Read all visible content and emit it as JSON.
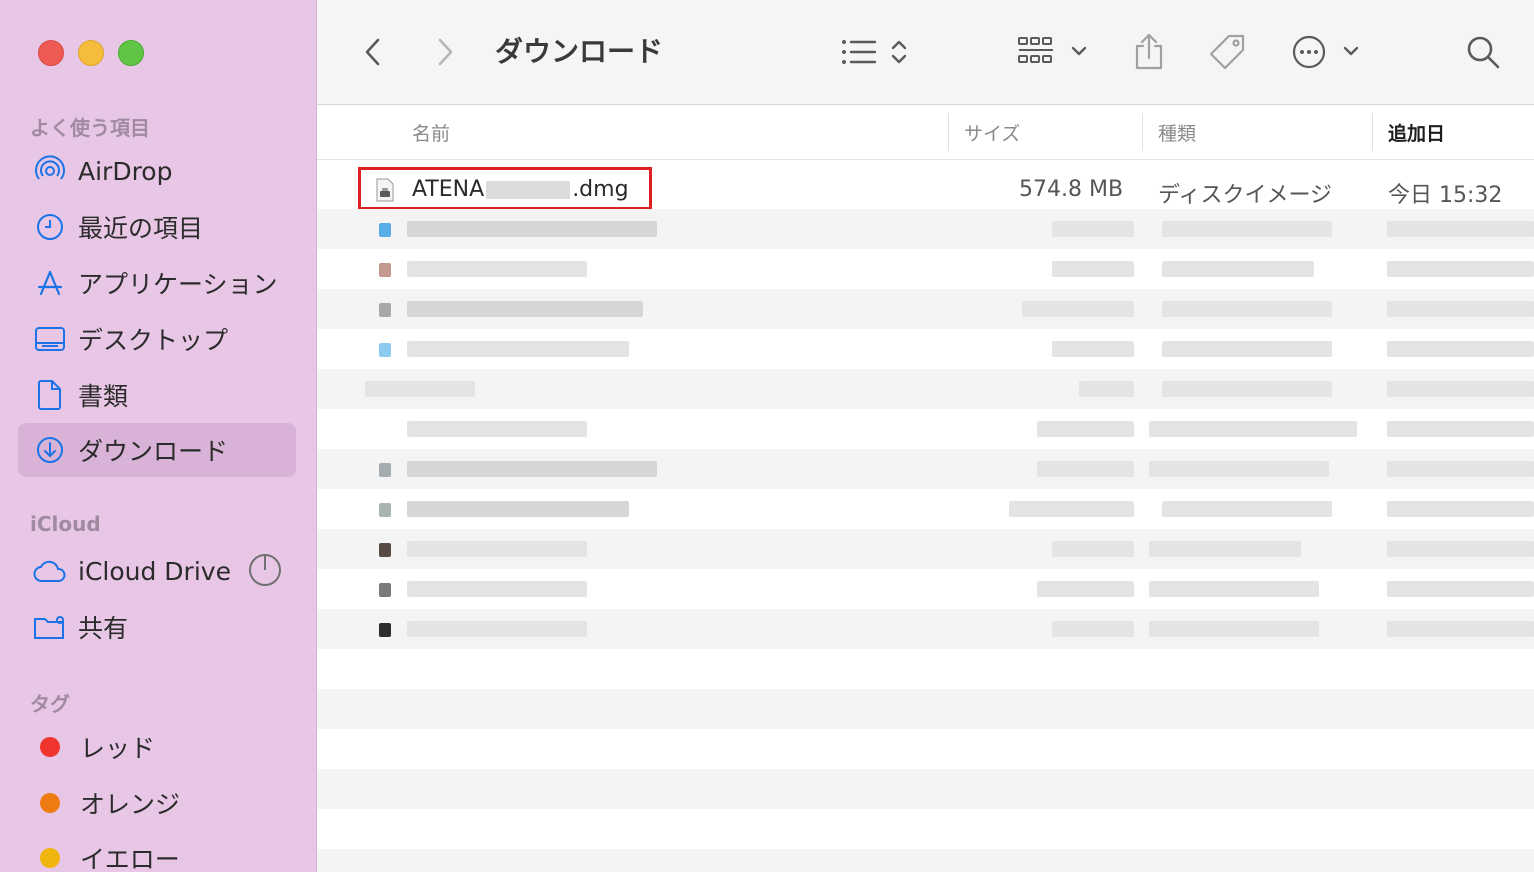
{
  "window": {
    "title": "ダウンロード"
  },
  "sidebar": {
    "favorites_header": "よく使う項目",
    "favorites": [
      {
        "label": "AirDrop",
        "icon": "airdrop-icon"
      },
      {
        "label": "最近の項目",
        "icon": "clock-icon"
      },
      {
        "label": "アプリケーション",
        "icon": "applications-icon"
      },
      {
        "label": "デスクトップ",
        "icon": "desktop-icon"
      },
      {
        "label": "書類",
        "icon": "document-icon"
      },
      {
        "label": "ダウンロード",
        "icon": "download-icon",
        "selected": true
      }
    ],
    "icloud_header": "iCloud",
    "icloud": [
      {
        "label": "iCloud Drive",
        "icon": "cloud-icon"
      },
      {
        "label": "共有",
        "icon": "shared-folder-icon"
      }
    ],
    "tags_header": "タグ",
    "tags": [
      {
        "label": "レッド",
        "color": "#f0352f"
      },
      {
        "label": "オレンジ",
        "color": "#ef7c12"
      },
      {
        "label": "イエロー",
        "color": "#efb50e"
      }
    ]
  },
  "toolbar": {
    "title": "ダウンロード"
  },
  "columns": {
    "name": "名前",
    "size": "サイズ",
    "kind": "種類",
    "date_added": "追加日"
  },
  "files": [
    {
      "name_prefix": "ATENA",
      "name_suffix": ".dmg",
      "size": "574.8 MB",
      "kind": "ディスクイメージ",
      "date_added": "今日 15:32"
    }
  ],
  "colors": {
    "sidebar_bg": "#e8c7e6",
    "selection": "#d9b3d7",
    "highlight_box": "#dd1f24",
    "accent": "#1a73e8"
  }
}
